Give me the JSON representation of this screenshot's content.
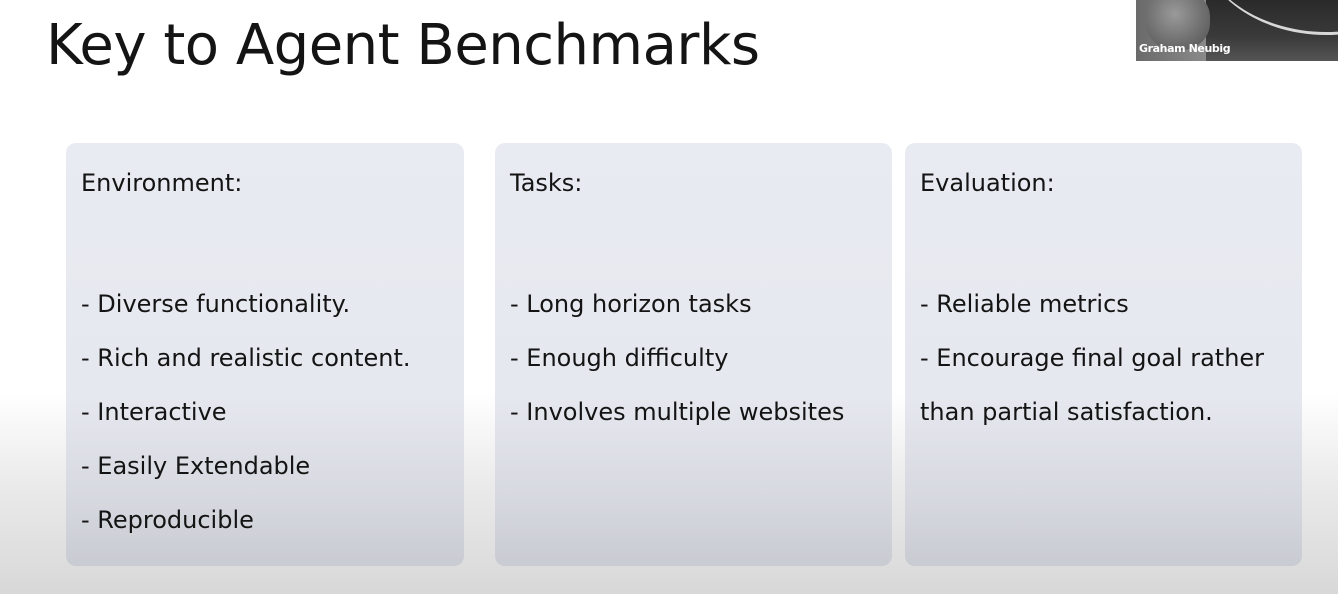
{
  "slide": {
    "title": "Key to Agent Benchmarks"
  },
  "video": {
    "participant_name": "Graham Neubig"
  },
  "cards": [
    {
      "heading": "Environment:",
      "items": [
        "- Diverse functionality.",
        "- Rich and realistic content.",
        "- Interactive",
        "- Easily Extendable",
        "- Reproducible"
      ]
    },
    {
      "heading": "Tasks:",
      "items": [
        "- Long horizon tasks",
        "- Enough difficulty",
        "- Involves multiple websites"
      ]
    },
    {
      "heading": "Evaluation:",
      "items": [
        "- Reliable metrics",
        "- Encourage final goal rather",
        "than partial satisfaction."
      ]
    }
  ],
  "colors": {
    "card_background": "#e7e9f0",
    "title_text": "#141414"
  }
}
